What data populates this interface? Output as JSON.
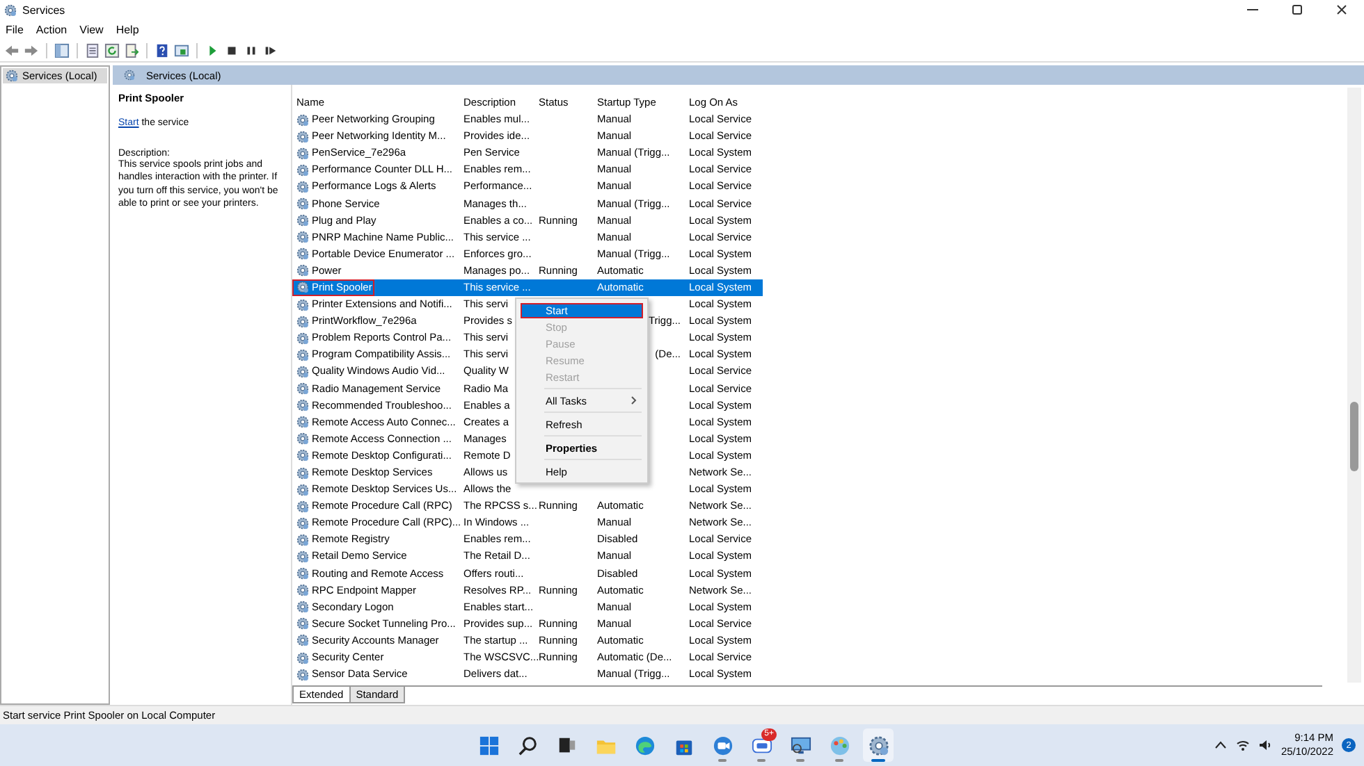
{
  "window": {
    "title": "Services"
  },
  "menu_bar": [
    {
      "label": "File"
    },
    {
      "label": "Action"
    },
    {
      "label": "View"
    },
    {
      "label": "Help"
    }
  ],
  "tree": {
    "items": [
      {
        "label": "Services (Local)",
        "selected": true
      }
    ]
  },
  "panel_header": "Services (Local)",
  "detail": {
    "title": "Print Spooler",
    "start_link": "Start",
    "start_rest": " the service",
    "description_label": "Description:",
    "description": "This service spools print jobs and handles interaction with the printer. If you turn off this service, you won't be able to print or see your printers."
  },
  "table": {
    "columns": [
      "Name",
      "Description",
      "Status",
      "Startup Type",
      "Log On As"
    ],
    "rows": [
      {
        "name": "Peer Networking Grouping",
        "description": "Enables mul...",
        "startup": "Manual",
        "logon": "Local Service",
        "selected": false
      },
      {
        "name": "Peer Networking Identity M...",
        "description": "Provides ide...",
        "startup": "Manual",
        "logon": "Local Service",
        "selected": false
      },
      {
        "name": "PenService_7e296a",
        "description": "Pen Service",
        "startup": "Manual (Trigg...",
        "logon": "Local System",
        "selected": false
      },
      {
        "name": "Performance Counter DLL H...",
        "description": "Enables rem...",
        "startup": "Manual",
        "logon": "Local Service",
        "selected": false
      },
      {
        "name": "Performance Logs & Alerts",
        "description": "Performance...",
        "startup": "Manual",
        "logon": "Local Service",
        "selected": false
      },
      {
        "name": "Phone Service",
        "description": "Manages th...",
        "startup": "Manual (Trigg...",
        "logon": "Local Service",
        "selected": false
      },
      {
        "name": "Plug and Play",
        "description": "Enables a co...",
        "status": "Running",
        "startup": "Manual",
        "logon": "Local System",
        "selected": false
      },
      {
        "name": "PNRP Machine Name Public...",
        "description": "This service ...",
        "startup": "Manual",
        "logon": "Local Service",
        "selected": false
      },
      {
        "name": "Portable Device Enumerator ...",
        "description": "Enforces gro...",
        "startup": "Manual (Trigg...",
        "logon": "Local System",
        "selected": false
      },
      {
        "name": "Power",
        "description": "Manages po...",
        "status": "Running",
        "startup": "Automatic",
        "logon": "Local System",
        "selected": false
      },
      {
        "name": "Print Spooler",
        "description": "This service ...",
        "startup": "Automatic",
        "logon": "Local System",
        "selected": true,
        "outlined": true
      },
      {
        "name": "Printer Extensions and Notifi...",
        "description": "This servi",
        "logon": "Local System",
        "selected": false
      },
      {
        "name": "PrintWorkflow_7e296a",
        "description": "Provides s",
        "startup": "Trigg...",
        "logon": "Local System",
        "selected": false
      },
      {
        "name": "Problem Reports Control Pa...",
        "description": "This servi",
        "logon": "Local System",
        "selected": false
      },
      {
        "name": "Program Compatibility Assis...",
        "description": "This servi",
        "startup": "(De...",
        "logon": "Local System",
        "selected": false
      },
      {
        "name": "Quality Windows Audio Vid...",
        "description": "Quality W",
        "logon": "Local Service",
        "selected": false
      },
      {
        "name": "Radio Management Service",
        "description": "Radio Ma",
        "logon": "Local Service",
        "selected": false
      },
      {
        "name": "Recommended Troubleshoo...",
        "description": "Enables a",
        "logon": "Local System",
        "selected": false
      },
      {
        "name": "Remote Access Auto Connec...",
        "description": "Creates a",
        "logon": "Local System",
        "selected": false
      },
      {
        "name": "Remote Access Connection ...",
        "description": "Manages",
        "logon": "Local System",
        "selected": false
      },
      {
        "name": "Remote Desktop Configurati...",
        "description": "Remote D",
        "logon": "Local System",
        "selected": false
      },
      {
        "name": "Remote Desktop Services",
        "description": "Allows us",
        "logon": "Network Se...",
        "selected": false
      },
      {
        "name": "Remote Desktop Services Us...",
        "description": "Allows the",
        "logon": "Local System",
        "selected": false
      },
      {
        "name": "Remote Procedure Call (RPC)",
        "description": "The RPCSS s...",
        "status": "Running",
        "startup": "Automatic",
        "logon": "Network Se...",
        "selected": false
      },
      {
        "name": "Remote Procedure Call (RPC)...",
        "description": "In Windows ...",
        "startup": "Manual",
        "logon": "Network Se...",
        "selected": false
      },
      {
        "name": "Remote Registry",
        "description": "Enables rem...",
        "startup": "Disabled",
        "logon": "Local Service",
        "selected": false
      },
      {
        "name": "Retail Demo Service",
        "description": "The Retail D...",
        "startup": "Manual",
        "logon": "Local System",
        "selected": false
      },
      {
        "name": "Routing and Remote Access",
        "description": "Offers routi...",
        "startup": "Disabled",
        "logon": "Local System",
        "selected": false
      },
      {
        "name": "RPC Endpoint Mapper",
        "description": "Resolves RP...",
        "status": "Running",
        "startup": "Automatic",
        "logon": "Network Se...",
        "selected": false
      },
      {
        "name": "Secondary Logon",
        "description": "Enables start...",
        "startup": "Manual",
        "logon": "Local System",
        "selected": false
      },
      {
        "name": "Secure Socket Tunneling Pro...",
        "description": "Provides sup...",
        "status": "Running",
        "startup": "Manual",
        "logon": "Local Service",
        "selected": false
      },
      {
        "name": "Security Accounts Manager",
        "description": "The startup ...",
        "status": "Running",
        "startup": "Automatic",
        "logon": "Local System",
        "selected": false
      },
      {
        "name": "Security Center",
        "description": "The WSCSVC...",
        "status": "Running",
        "startup": "Automatic (De...",
        "logon": "Local Service",
        "selected": false
      },
      {
        "name": "Sensor Data Service",
        "description": "Delivers dat...",
        "startup": "Manual (Trigg...",
        "logon": "Local System",
        "selected": false
      }
    ]
  },
  "context_menu": {
    "items": [
      {
        "kind": "item",
        "label": "Start",
        "disabled": false,
        "selected": true,
        "outlined": true
      },
      {
        "kind": "item",
        "label": "Stop",
        "disabled": true,
        "selected": false
      },
      {
        "kind": "item",
        "label": "Pause",
        "disabled": true,
        "selected": false
      },
      {
        "kind": "item",
        "label": "Resume",
        "disabled": true,
        "selected": false
      },
      {
        "kind": "item",
        "label": "Restart",
        "disabled": true,
        "selected": false
      },
      {
        "kind": "separator"
      },
      {
        "kind": "item",
        "label": "All Tasks",
        "disabled": false,
        "selected": false,
        "submenu": true
      },
      {
        "kind": "separator"
      },
      {
        "kind": "item",
        "label": "Refresh",
        "disabled": false,
        "selected": false
      },
      {
        "kind": "separator"
      },
      {
        "kind": "item",
        "label": "Properties",
        "disabled": false,
        "selected": false,
        "bold": true
      },
      {
        "kind": "separator"
      },
      {
        "kind": "item",
        "label": "Help",
        "disabled": false,
        "selected": false
      }
    ]
  },
  "view_tabs": [
    {
      "label": "Extended",
      "selected": true
    },
    {
      "label": "Standard",
      "selected": false
    }
  ],
  "status_bar": "Start service Print Spooler on Local Computer",
  "taskbar": {
    "apps": [
      {
        "kind": "start",
        "running": false,
        "active": false
      },
      {
        "kind": "search",
        "running": false,
        "active": false
      },
      {
        "kind": "taskview",
        "running": false,
        "active": false
      },
      {
        "kind": "explorer",
        "running": false,
        "active": false
      },
      {
        "kind": "edge",
        "running": false,
        "active": false
      },
      {
        "kind": "store",
        "running": false,
        "active": false
      },
      {
        "kind": "camera",
        "running": true,
        "active": false
      },
      {
        "kind": "chat",
        "running": true,
        "active": false,
        "badge": "5+"
      },
      {
        "kind": "remote",
        "running": true,
        "active": false
      },
      {
        "kind": "paint",
        "running": true,
        "active": false
      },
      {
        "kind": "services",
        "running": true,
        "active": true
      }
    ],
    "time": "9:14 PM",
    "date": "25/10/2022",
    "notifications": "2"
  }
}
